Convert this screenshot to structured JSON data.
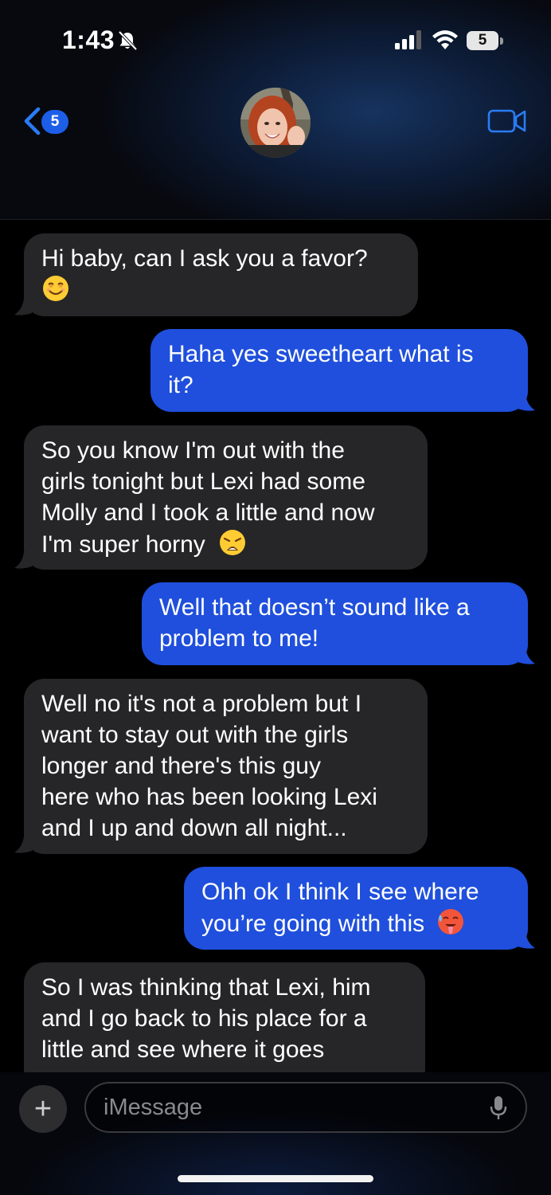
{
  "status_bar": {
    "time": "1:43",
    "battery_level": "5"
  },
  "header": {
    "back_count": "5",
    "icons": [
      "chevron-left-icon",
      "video-camera-icon",
      "bell-slash-icon",
      "signal-icon",
      "wifi-icon",
      "battery-icon"
    ]
  },
  "messages": [
    {
      "direction": "incoming",
      "text": "Hi baby, can I ask you a favor?",
      "lines": [
        "Hi baby, can I ask you a favor?"
      ],
      "emoji": "smiling-face-icon"
    },
    {
      "direction": "outgoing",
      "text": "Haha yes sweetheart what is it?",
      "lines": [
        "Haha yes sweetheart what is",
        "it?"
      ]
    },
    {
      "direction": "incoming",
      "text": "So you know I'm out with the girls tonight but Lexi had some Molly and I took a little and now I'm super horny",
      "lines": [
        "So you know I'm out with the",
        "girls tonight but Lexi had some",
        "Molly and I took a little and now",
        "I'm super horny"
      ],
      "emoji": "weary-face-icon"
    },
    {
      "direction": "outgoing",
      "text": "Well that doesn’t sound like a problem to me!",
      "lines": [
        "Well that doesn’t sound like a",
        "problem to me!"
      ]
    },
    {
      "direction": "incoming",
      "text": "Well no it's not a problem but I want to stay out with the girls longer and there's this guy here who has been looking Lexi and I up and down all night...",
      "lines": [
        "Well no it's not a problem but I",
        "want to stay out with the girls",
        "longer and there's this guy",
        "here who has been looking Lexi",
        "and I up and down all night..."
      ]
    },
    {
      "direction": "outgoing",
      "text": "Ohh ok I think I see where you’re going with this",
      "lines": [
        "Ohh ok I think I see where",
        "you’re going with this"
      ],
      "emoji": "hot-face-icon"
    },
    {
      "direction": "incoming",
      "text": "So I was thinking that Lexi, him and I go back to his place for a little and see where it goes",
      "lines": [
        "So I was thinking that Lexi, him",
        "and I go back to his place for a",
        "little and see where it goes"
      ]
    }
  ],
  "composer": {
    "placeholder": "iMessage",
    "plus_label": "+"
  },
  "colors": {
    "incoming_bubble": "#262628",
    "outgoing_bubble": "#1f4fdc",
    "accent": "#1d5ee8"
  }
}
